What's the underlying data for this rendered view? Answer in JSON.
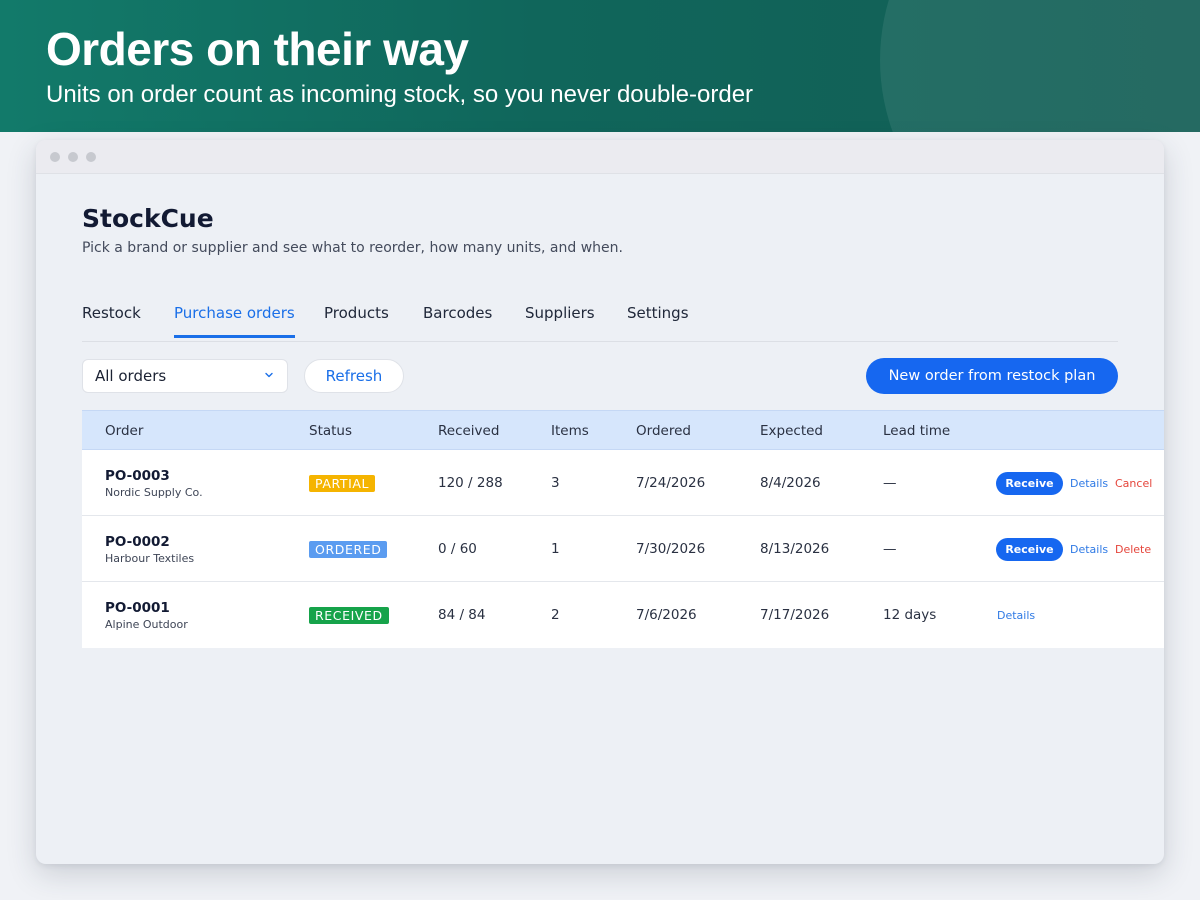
{
  "banner": {
    "title": "Orders on their way",
    "subtitle": "Units on order count as incoming stock, so you never double-order"
  },
  "app": {
    "name": "StockCue",
    "tagline": "Pick a brand or supplier and see what to reorder, how many units, and when."
  },
  "tabs": [
    {
      "label": "Restock",
      "active": false
    },
    {
      "label": "Purchase orders",
      "active": true
    },
    {
      "label": "Products",
      "active": false
    },
    {
      "label": "Barcodes",
      "active": false
    },
    {
      "label": "Suppliers",
      "active": false
    },
    {
      "label": "Settings",
      "active": false
    }
  ],
  "toolbar": {
    "filter_value": "All orders",
    "filter_icon": "chevron-down-icon",
    "refresh_label": "Refresh",
    "primary_label": "New order from restock plan"
  },
  "table": {
    "columns": [
      "Order",
      "Status",
      "Received",
      "Items",
      "Ordered",
      "Expected",
      "Lead time"
    ],
    "rows": [
      {
        "order": "PO-0003",
        "supplier": "Nordic Supply Co.",
        "status": "PARTIAL",
        "status_color": "#f5b400",
        "received": "120 / 288",
        "items": "3",
        "ordered": "7/24/2026",
        "expected": "8/4/2026",
        "lead_time": "—",
        "receive_label": "Receive",
        "details_label": "Details",
        "danger_label": "Cancel"
      },
      {
        "order": "PO-0002",
        "supplier": "Harbour Textiles",
        "status": "ORDERED",
        "status_color": "#5b9cf0",
        "received": "0 / 60",
        "items": "1",
        "ordered": "7/30/2026",
        "expected": "8/13/2026",
        "lead_time": "—",
        "receive_label": "Receive",
        "details_label": "Details",
        "danger_label": "Delete"
      },
      {
        "order": "PO-0001",
        "supplier": "Alpine Outdoor",
        "status": "RECEIVED",
        "status_color": "#16a34a",
        "received": "84 / 84",
        "items": "2",
        "ordered": "7/6/2026",
        "expected": "7/17/2026",
        "lead_time": "12 days",
        "details_label": "Details"
      }
    ]
  },
  "colors": {
    "banner": "#127a6a",
    "accent": "#1667f0",
    "header_row": "#d6e6fc",
    "danger": "#e5453b"
  }
}
